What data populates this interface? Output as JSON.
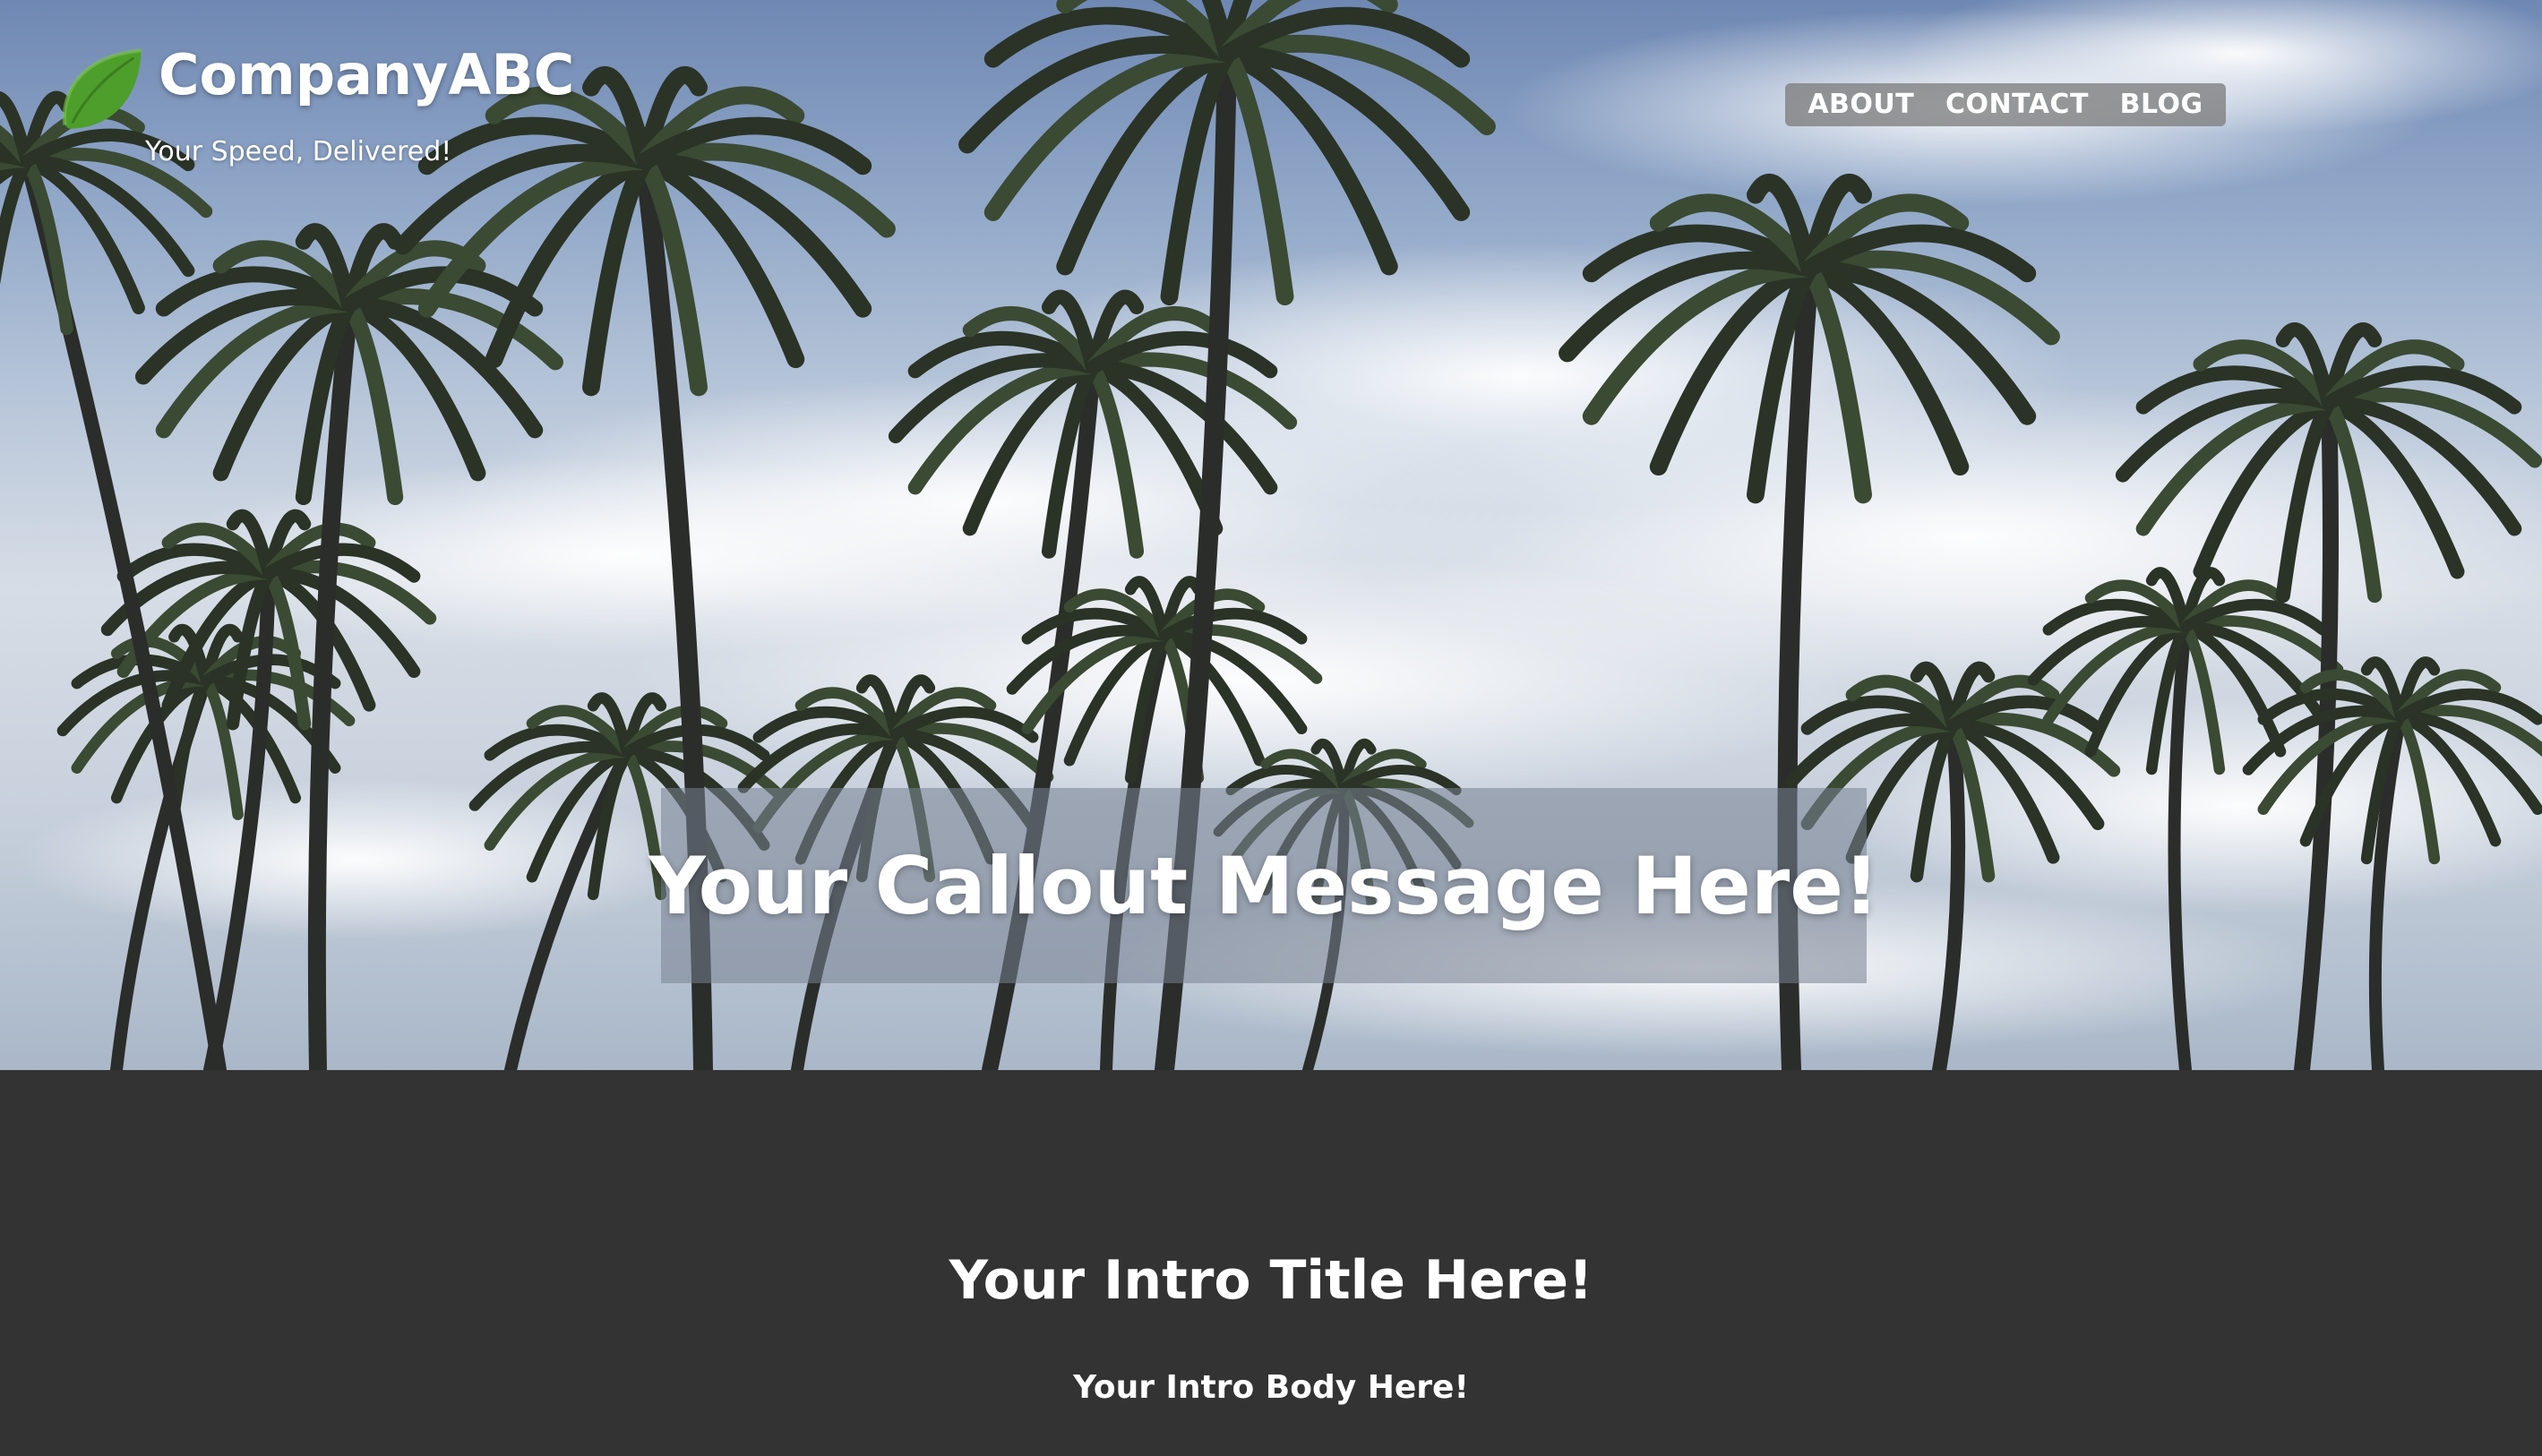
{
  "brand": {
    "name": "CompanyABC",
    "tagline": "Your Speed, Delivered!",
    "logo_icon": "leaf-icon",
    "logo_color": "#4a9a2a"
  },
  "nav": {
    "items": [
      {
        "label": "ABOUT"
      },
      {
        "label": "CONTACT"
      },
      {
        "label": "BLOG"
      }
    ]
  },
  "hero": {
    "background_image": "palm-trees-sky-photo",
    "callout": "Your Callout Message Here!"
  },
  "intro": {
    "title": "Your Intro Title Here!",
    "body": "Your Intro Body Here!",
    "background_color": "#333333"
  }
}
